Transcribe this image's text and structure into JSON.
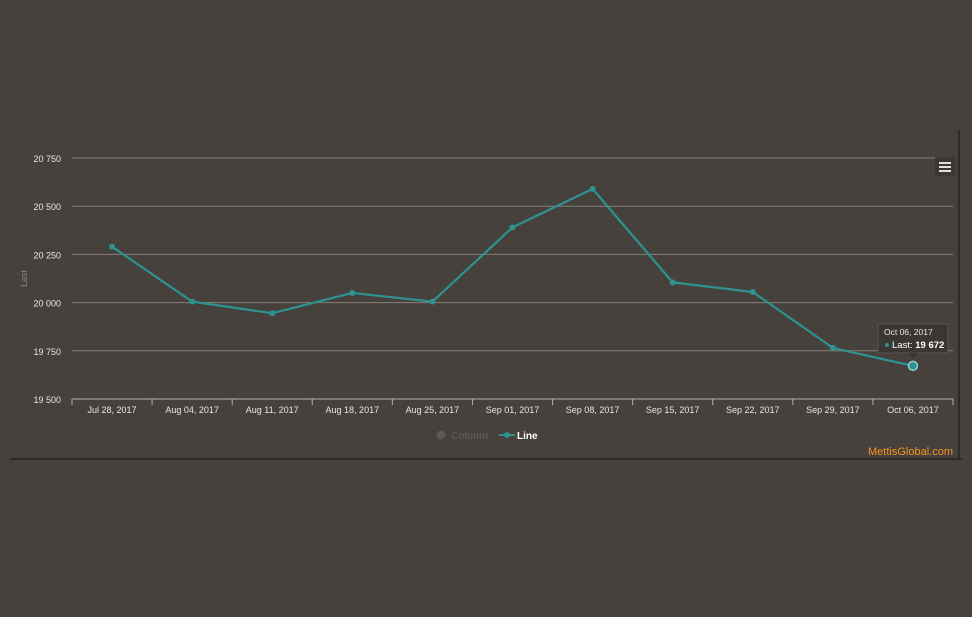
{
  "chart_data": {
    "type": "line",
    "title": "",
    "xlabel": "",
    "ylabel": "Last",
    "categories": [
      "Jul 28, 2017",
      "Aug 04, 2017",
      "Aug 11, 2017",
      "Aug 18, 2017",
      "Aug 25, 2017",
      "Sep 01, 2017",
      "Sep 08, 2017",
      "Sep 15, 2017",
      "Sep 22, 2017",
      "Sep 29, 2017",
      "Oct 06, 2017"
    ],
    "series": [
      {
        "name": "Line",
        "color": "#2e9390",
        "values": [
          20290,
          20005,
          19945,
          20050,
          20005,
          20390,
          20590,
          20105,
          20055,
          19765,
          19672
        ]
      }
    ],
    "yticks": [
      19500,
      19750,
      20000,
      20250,
      20500,
      20750
    ],
    "ytick_labels": [
      "19 500",
      "19 750",
      "20 000",
      "20 250",
      "20 500",
      "20 750"
    ],
    "ylim": [
      19500,
      20750
    ],
    "grid": true,
    "legend": {
      "placement": "bottom-center",
      "items": [
        {
          "name": "Column",
          "color": "#5d5955",
          "active": false
        },
        {
          "name": "Line",
          "color": "#2e9390",
          "active": true
        }
      ]
    },
    "tooltip": {
      "title": "Oct 06, 2017",
      "label": "Last:",
      "value": "19 672",
      "point_index": 10
    }
  },
  "ui": {
    "credit": "MettisGlobal.com",
    "menu_icon": "hamburger-menu-icon"
  }
}
